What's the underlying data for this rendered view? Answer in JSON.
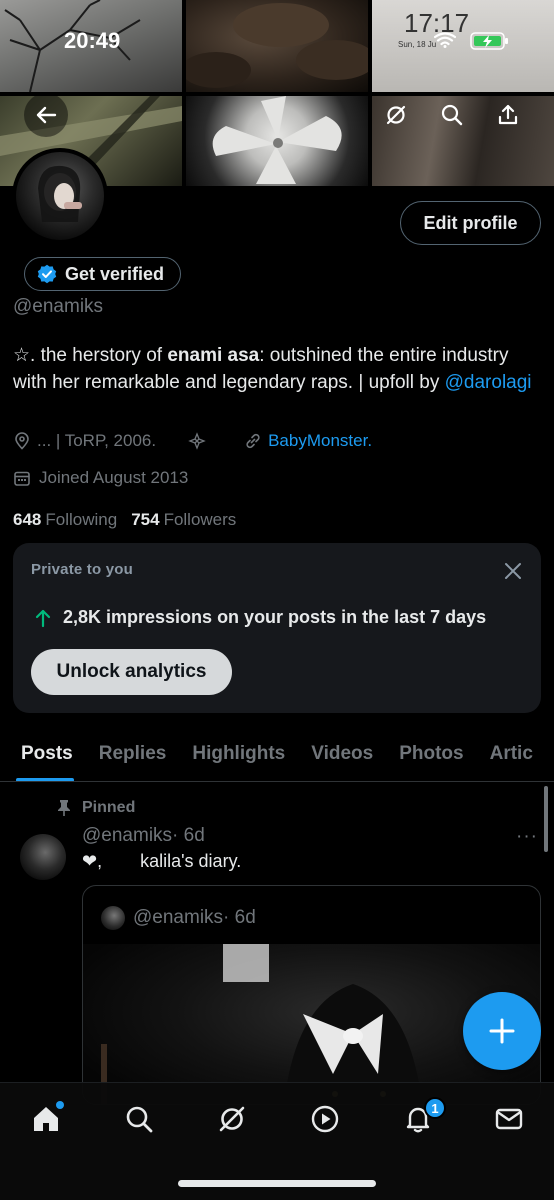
{
  "status_bar": {
    "time_left": "20:49",
    "time_right": "17:17",
    "date": "Sun, 18 Ju"
  },
  "header_actions": {
    "back_icon": "arrow-left-icon",
    "refresh_icon": "grok-icon",
    "search_icon": "search-icon",
    "share_icon": "share-icon"
  },
  "profile": {
    "edit_profile_label": "Edit profile",
    "get_verified_label": "Get verified",
    "handle": "@enamiks",
    "bio_prefix": "☆. the herstory of ",
    "bio_bold": "enami asa",
    "bio_middle": ": outshined the entire industry with her remarkable and legendary raps. | upfoll by ",
    "bio_mention": "@darolagi",
    "location": "... | ToRP, 2006.",
    "link": "BabyMonster.",
    "joined": "Joined August 2013",
    "following_count": "648",
    "following_label": "Following",
    "followers_count": "754",
    "followers_label": "Followers"
  },
  "analytics_card": {
    "label": "Private to you",
    "stat": "2,8K impressions on your posts in the last 7 days",
    "button_label": "Unlock analytics"
  },
  "tabs": [
    {
      "label": "Posts",
      "active": true
    },
    {
      "label": "Replies"
    },
    {
      "label": "Highlights"
    },
    {
      "label": "Videos"
    },
    {
      "label": "Photos"
    },
    {
      "label": "Artic"
    }
  ],
  "post": {
    "pinned_label": "Pinned",
    "author": "@enamiks",
    "time": "· 6d",
    "more": "···",
    "text_lead": "❤,",
    "text_body": "kalila's diary.",
    "quote_author": "@enamiks",
    "quote_time": "· 6d"
  },
  "bottom_nav": {
    "notifications_badge": "1"
  },
  "colors": {
    "accent": "#1d9bf0",
    "background": "#000000",
    "muted_text": "#71767b",
    "primary_text": "#e7e9ea",
    "card_bg": "#16181c",
    "stat_arrow": "#00ba7c"
  }
}
